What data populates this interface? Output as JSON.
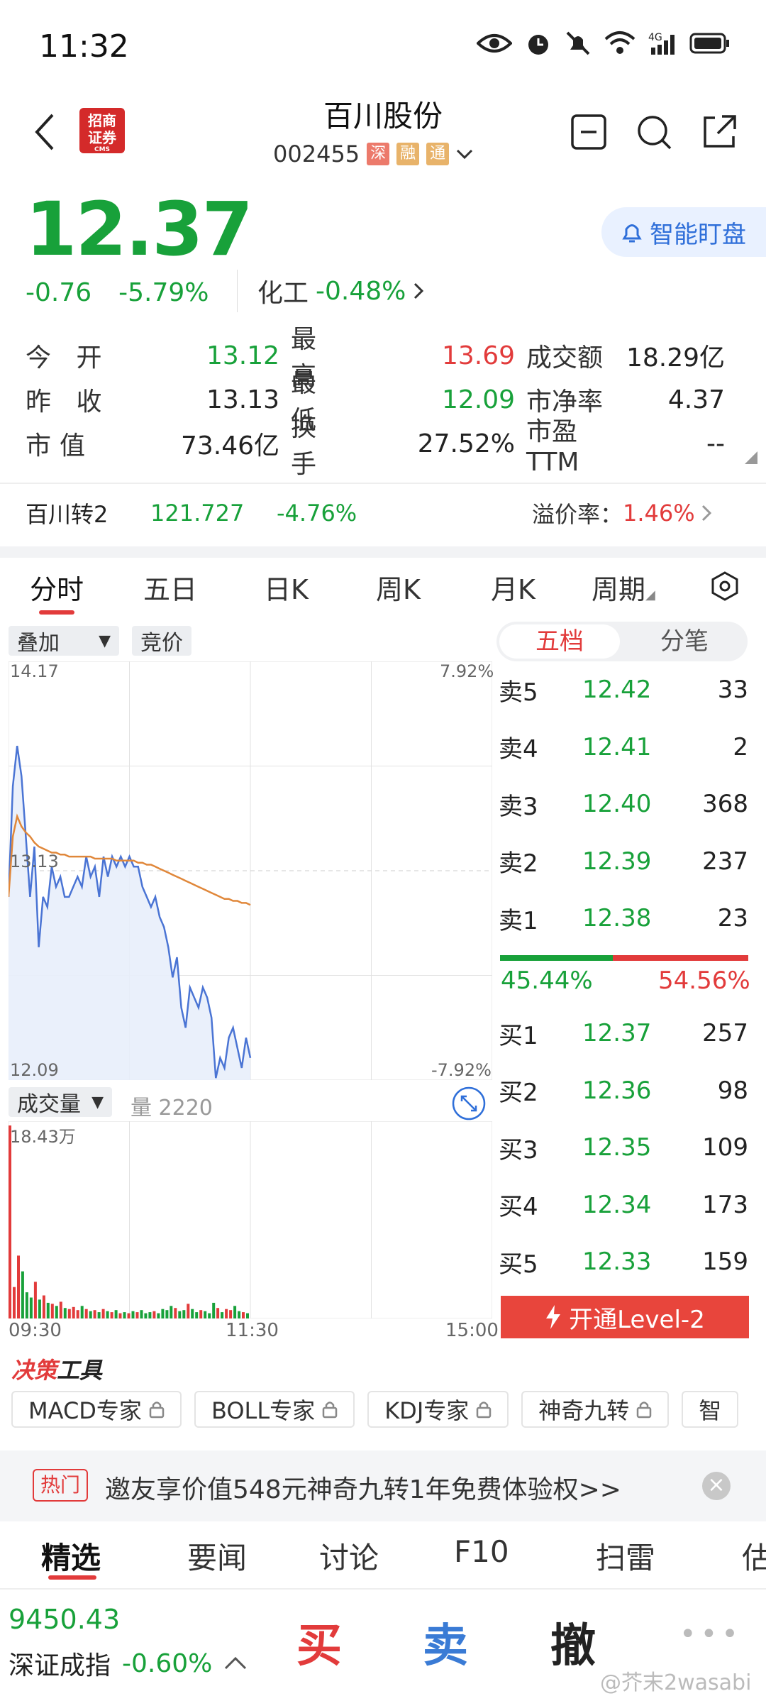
{
  "status": {
    "time": "11:32"
  },
  "header": {
    "title": "百川股份",
    "code": "002455",
    "tags": [
      "深",
      "融",
      "通"
    ]
  },
  "quote": {
    "price": "12.37",
    "change": "-0.76",
    "change_pct": "-5.79%",
    "sector": "化工",
    "sector_pct": "-0.48%",
    "smart_btn": "智能盯盘"
  },
  "stats": [
    {
      "l1": "今 开",
      "v1": "13.12",
      "c1": "green",
      "l2": "最 高",
      "v2": "13.69",
      "c2": "red",
      "l3": "成交额",
      "v3": "18.29亿"
    },
    {
      "l1": "昨 收",
      "v1": "13.13",
      "c1": "dark",
      "l2": "最 低",
      "v2": "12.09",
      "c2": "green",
      "l3": "市净率",
      "v3": "4.37"
    },
    {
      "l1": "市值",
      "v1": "73.46亿",
      "c1": "dark",
      "l2": "换 手",
      "v2": "27.52%",
      "c2": "dark",
      "l3": "市盈TTM",
      "v3": "--"
    }
  ],
  "bond": {
    "name": "百川转2",
    "price": "121.727",
    "pct": "-4.76%",
    "premium_label": "溢价率：",
    "premium": "1.46%"
  },
  "tabs": [
    "分时",
    "五日",
    "日K",
    "周K",
    "月K",
    "周期"
  ],
  "chart": {
    "overlay": "叠加",
    "auction": "竞价",
    "y_top": "14.17",
    "y_mid": "13.13",
    "y_bot": "12.09",
    "pct_top": "7.92%",
    "pct_bot": "-7.92%",
    "vol_label": "成交量",
    "vol_value": "量 2220",
    "vol_max": "18.43万",
    "t0": "09:30",
    "t1": "11:30",
    "t2": "15:00"
  },
  "orderbook": {
    "seg": [
      "五档",
      "分笔"
    ],
    "asks": [
      {
        "l": "卖5",
        "p": "12.42",
        "v": "33"
      },
      {
        "l": "卖4",
        "p": "12.41",
        "v": "2"
      },
      {
        "l": "卖3",
        "p": "12.40",
        "v": "368"
      },
      {
        "l": "卖2",
        "p": "12.39",
        "v": "237"
      },
      {
        "l": "卖1",
        "p": "12.38",
        "v": "23"
      }
    ],
    "buy_ratio": "45.44%",
    "sell_ratio": "54.56%",
    "bids": [
      {
        "l": "买1",
        "p": "12.37",
        "v": "257"
      },
      {
        "l": "买2",
        "p": "12.36",
        "v": "98"
      },
      {
        "l": "买3",
        "p": "12.35",
        "v": "109"
      },
      {
        "l": "买4",
        "p": "12.34",
        "v": "173"
      },
      {
        "l": "买5",
        "p": "12.33",
        "v": "159"
      }
    ],
    "level2": "开通Level-2"
  },
  "tools": {
    "title_a": "决策",
    "title_b": "工具",
    "items": [
      "MACD专家",
      "BOLL专家",
      "KDJ专家",
      "神奇九转",
      "智"
    ]
  },
  "banner": {
    "hot": "热门",
    "text": "邀友享价值548元神奇九转1年免费体验权>>"
  },
  "bottom_tabs": [
    "精选",
    "要闻",
    "讨论",
    "F10",
    "扫雷",
    "估"
  ],
  "index": {
    "value": "9450.43",
    "name": "深证成指",
    "pct": "-0.60%"
  },
  "actions": {
    "buy": "买",
    "sell": "卖",
    "cancel": "撤"
  },
  "watermark": "@芥末2wasabi",
  "colors": {
    "up": "#e23b3b",
    "down": "#18a13a",
    "accent": "#2f6fd9",
    "avg_line": "#e0873a",
    "price_line": "#4a74d4"
  },
  "chart_data": {
    "type": "line",
    "y_range": [
      12.09,
      14.17
    ],
    "ref": 13.13,
    "price": [
      13.0,
      13.55,
      13.75,
      13.6,
      13.3,
      13.0,
      13.25,
      12.75,
      13.0,
      12.95,
      13.15,
      13.05,
      13.1,
      13.0,
      13.0,
      13.05,
      13.1,
      13.05,
      13.2,
      13.1,
      13.15,
      13.0,
      13.2,
      13.1,
      13.2,
      13.15,
      13.2,
      13.15,
      13.2,
      13.15,
      13.15,
      13.05,
      13.0,
      12.95,
      13.0,
      12.9,
      12.85,
      12.75,
      12.6,
      12.7,
      12.45,
      12.35,
      12.55,
      12.5,
      12.45,
      12.55,
      12.5,
      12.4,
      12.1,
      12.2,
      12.15,
      12.3,
      12.35,
      12.25,
      12.15,
      12.3,
      12.2
    ],
    "avg": [
      13.0,
      13.3,
      13.4,
      13.35,
      13.32,
      13.3,
      13.27,
      13.25,
      13.24,
      13.23,
      13.22,
      13.22,
      13.21,
      13.21,
      13.2,
      13.2,
      13.2,
      13.2,
      13.2,
      13.2,
      13.19,
      13.19,
      13.19,
      13.19,
      13.19,
      13.18,
      13.18,
      13.18,
      13.18,
      13.18,
      13.17,
      13.17,
      13.16,
      13.16,
      13.15,
      13.14,
      13.13,
      13.12,
      13.11,
      13.1,
      13.09,
      13.08,
      13.07,
      13.06,
      13.05,
      13.04,
      13.03,
      13.02,
      13.01,
      13.0,
      12.99,
      12.99,
      12.98,
      12.98,
      12.97,
      12.97,
      12.96
    ],
    "volume_max": 184300,
    "volume": [
      184300,
      30000,
      60000,
      45000,
      25000,
      20000,
      35000,
      18000,
      22000,
      15000,
      14000,
      12000,
      16000,
      10000,
      9000,
      11000,
      8000,
      12000,
      9000,
      7000,
      8000,
      6000,
      9000,
      7000,
      6000,
      8000,
      5000,
      6000,
      5000,
      7000,
      6000,
      8000,
      5000,
      6000,
      7000,
      5000,
      9000,
      8000,
      12000,
      10000,
      7000,
      8000,
      14000,
      9000,
      6000,
      8000,
      7000,
      5000,
      15000,
      10000,
      6000,
      9000,
      8000,
      12000,
      7000,
      6000,
      5000
    ]
  }
}
